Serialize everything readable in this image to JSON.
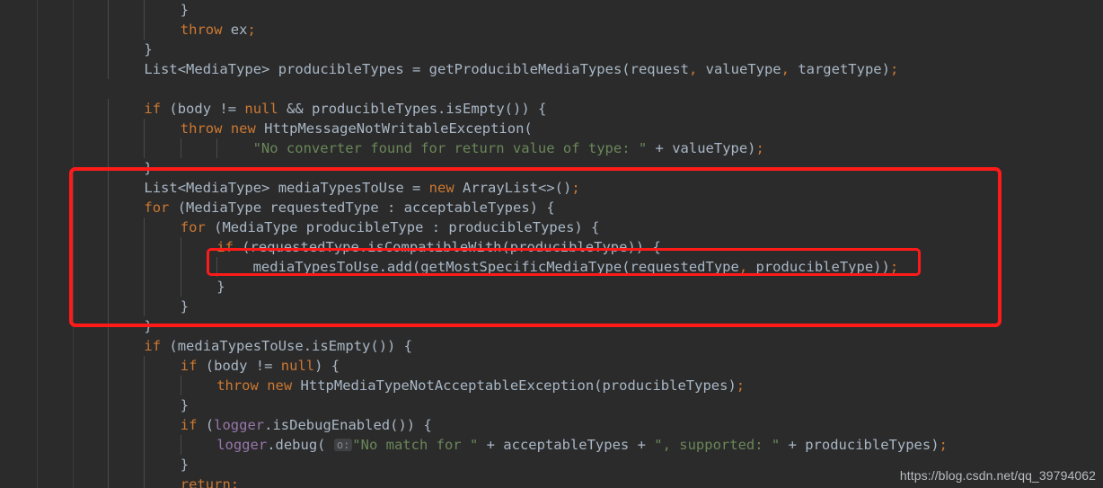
{
  "editor": {
    "theme_name": "darcula",
    "background_color": "#2b2b2b",
    "default_text_color": "#a9b7c6",
    "keyword_color": "#cc7832",
    "string_color": "#6a8759",
    "field_color": "#9876aa",
    "highlight_box_color": "#ff1a1a",
    "language": "java"
  },
  "code": {
    "lines": [
      {
        "indent": 8,
        "segments": [
          {
            "t": "}",
            "c": "txt"
          }
        ]
      },
      {
        "indent": 8,
        "segments": [
          {
            "t": "throw",
            "c": "kw"
          },
          {
            "t": " ex",
            "c": "txt"
          },
          {
            "t": ";",
            "c": "pun"
          }
        ]
      },
      {
        "indent": 4,
        "segments": [
          {
            "t": "}",
            "c": "txt"
          }
        ]
      },
      {
        "indent": 4,
        "segments": [
          {
            "t": "List<MediaType> producibleTypes = getProducibleMediaTypes(request",
            "c": "txt"
          },
          {
            "t": ",",
            "c": "pun"
          },
          {
            "t": " valueType",
            "c": "txt"
          },
          {
            "t": ",",
            "c": "pun"
          },
          {
            "t": " targetType)",
            "c": "txt"
          },
          {
            "t": ";",
            "c": "pun"
          }
        ]
      },
      {
        "indent": 0,
        "segments": []
      },
      {
        "indent": 4,
        "segments": [
          {
            "t": "if",
            "c": "kw"
          },
          {
            "t": " (body != ",
            "c": "txt"
          },
          {
            "t": "null",
            "c": "kw"
          },
          {
            "t": " && producibleTypes.isEmpty()) {",
            "c": "txt"
          }
        ]
      },
      {
        "indent": 8,
        "segments": [
          {
            "t": "throw",
            "c": "kw"
          },
          {
            "t": " ",
            "c": "txt"
          },
          {
            "t": "new",
            "c": "kw"
          },
          {
            "t": " HttpMessageNotWritableException(",
            "c": "txt"
          }
        ]
      },
      {
        "indent": 16,
        "segments": [
          {
            "t": "\"No converter found for return value of type: \"",
            "c": "str"
          },
          {
            "t": " + valueType)",
            "c": "txt"
          },
          {
            "t": ";",
            "c": "pun"
          }
        ]
      },
      {
        "indent": 4,
        "segments": [
          {
            "t": "}",
            "c": "txt"
          }
        ]
      },
      {
        "indent": 4,
        "segments": [
          {
            "t": "List<MediaType> mediaTypesToUse = ",
            "c": "txt"
          },
          {
            "t": "new",
            "c": "kw"
          },
          {
            "t": " ArrayList<>()",
            "c": "txt"
          },
          {
            "t": ";",
            "c": "pun"
          }
        ]
      },
      {
        "indent": 4,
        "segments": [
          {
            "t": "for",
            "c": "kw"
          },
          {
            "t": " (MediaType requestedType : acceptableTypes) {",
            "c": "txt"
          }
        ]
      },
      {
        "indent": 8,
        "segments": [
          {
            "t": "for",
            "c": "kw"
          },
          {
            "t": " (MediaType producibleType : producibleTypes) {",
            "c": "txt"
          }
        ]
      },
      {
        "indent": 12,
        "segments": [
          {
            "t": "if",
            "c": "kw"
          },
          {
            "t": " (requestedType.isCompatibleWith(producibleType)) {",
            "c": "txt"
          }
        ]
      },
      {
        "indent": 16,
        "segments": [
          {
            "t": "mediaTypesToUse.add(getMostSpecificMediaType(requestedType",
            "c": "txt"
          },
          {
            "t": ",",
            "c": "pun"
          },
          {
            "t": " producibleType))",
            "c": "txt"
          },
          {
            "t": ";",
            "c": "pun"
          }
        ]
      },
      {
        "indent": 12,
        "segments": [
          {
            "t": "}",
            "c": "txt"
          }
        ]
      },
      {
        "indent": 8,
        "segments": [
          {
            "t": "}",
            "c": "txt"
          }
        ]
      },
      {
        "indent": 4,
        "segments": [
          {
            "t": "}",
            "c": "txt"
          }
        ]
      },
      {
        "indent": 4,
        "segments": [
          {
            "t": "if",
            "c": "kw"
          },
          {
            "t": " (mediaTypesToUse.isEmpty()) {",
            "c": "txt"
          }
        ]
      },
      {
        "indent": 8,
        "segments": [
          {
            "t": "if",
            "c": "kw"
          },
          {
            "t": " (body != ",
            "c": "txt"
          },
          {
            "t": "null",
            "c": "kw"
          },
          {
            "t": ") {",
            "c": "txt"
          }
        ]
      },
      {
        "indent": 12,
        "segments": [
          {
            "t": "throw",
            "c": "kw"
          },
          {
            "t": " ",
            "c": "txt"
          },
          {
            "t": "new",
            "c": "kw"
          },
          {
            "t": " HttpMediaTypeNotAcceptableException(producibleTypes)",
            "c": "txt"
          },
          {
            "t": ";",
            "c": "pun"
          }
        ]
      },
      {
        "indent": 8,
        "segments": [
          {
            "t": "}",
            "c": "txt"
          }
        ]
      },
      {
        "indent": 8,
        "segments": [
          {
            "t": "if",
            "c": "kw"
          },
          {
            "t": " (",
            "c": "txt"
          },
          {
            "t": "logger",
            "c": "fld"
          },
          {
            "t": ".isDebugEnabled()) {",
            "c": "txt"
          }
        ]
      },
      {
        "indent": 12,
        "segments": [
          {
            "t": "logger",
            "c": "fld"
          },
          {
            "t": ".debug( ",
            "c": "txt"
          },
          {
            "t": "o:",
            "c": "hint"
          },
          {
            "t": "\"No match for \"",
            "c": "str"
          },
          {
            "t": " + acceptableTypes + ",
            "c": "txt"
          },
          {
            "t": "\", supported: \"",
            "c": "str"
          },
          {
            "t": " + producibleTypes)",
            "c": "txt"
          },
          {
            "t": ";",
            "c": "pun"
          }
        ]
      },
      {
        "indent": 8,
        "segments": [
          {
            "t": "}",
            "c": "txt"
          }
        ]
      },
      {
        "indent": 8,
        "segments": [
          {
            "t": "return",
            "c": "kw"
          },
          {
            "t": ";",
            "c": "pun"
          }
        ]
      }
    ]
  },
  "annotations": {
    "outer_box_label": "highlighted-code-block",
    "inner_box_label": "highlighted-code-statement"
  },
  "watermark": {
    "text": "https://blog.csdn.net/qq_39794062"
  }
}
